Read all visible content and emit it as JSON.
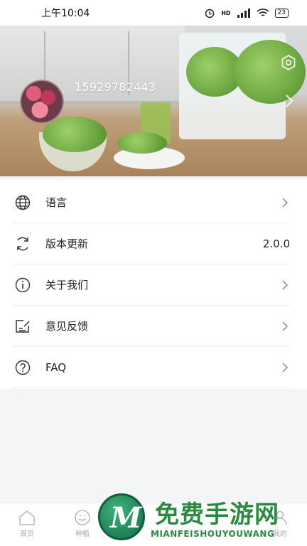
{
  "status_bar": {
    "time": "上午10:04",
    "hd": "HD",
    "battery": "23"
  },
  "profile": {
    "phone": "15929782443"
  },
  "menu": {
    "items": [
      {
        "label": "语言",
        "icon": "globe-icon"
      },
      {
        "label": "版本更新",
        "value": "2.0.0",
        "icon": "refresh-icon"
      },
      {
        "label": "关于我们",
        "icon": "info-icon"
      },
      {
        "label": "意见反馈",
        "icon": "feedback-icon"
      },
      {
        "label": "FAQ",
        "icon": "help-icon"
      }
    ]
  },
  "tabbar": {
    "tabs": [
      {
        "label": "首页",
        "icon": "home-icon"
      },
      {
        "label": "种植",
        "icon": "plant-icon"
      },
      {
        "label": "我的",
        "icon": "profile-icon"
      }
    ]
  },
  "watermark": {
    "cn": "免费手游网",
    "en": "MIANFEISHOUYOUWANG",
    "logo_letter": "M"
  },
  "colors": {
    "accent": "#2c8a40",
    "text": "#222222",
    "background": "#f4f5f7"
  }
}
